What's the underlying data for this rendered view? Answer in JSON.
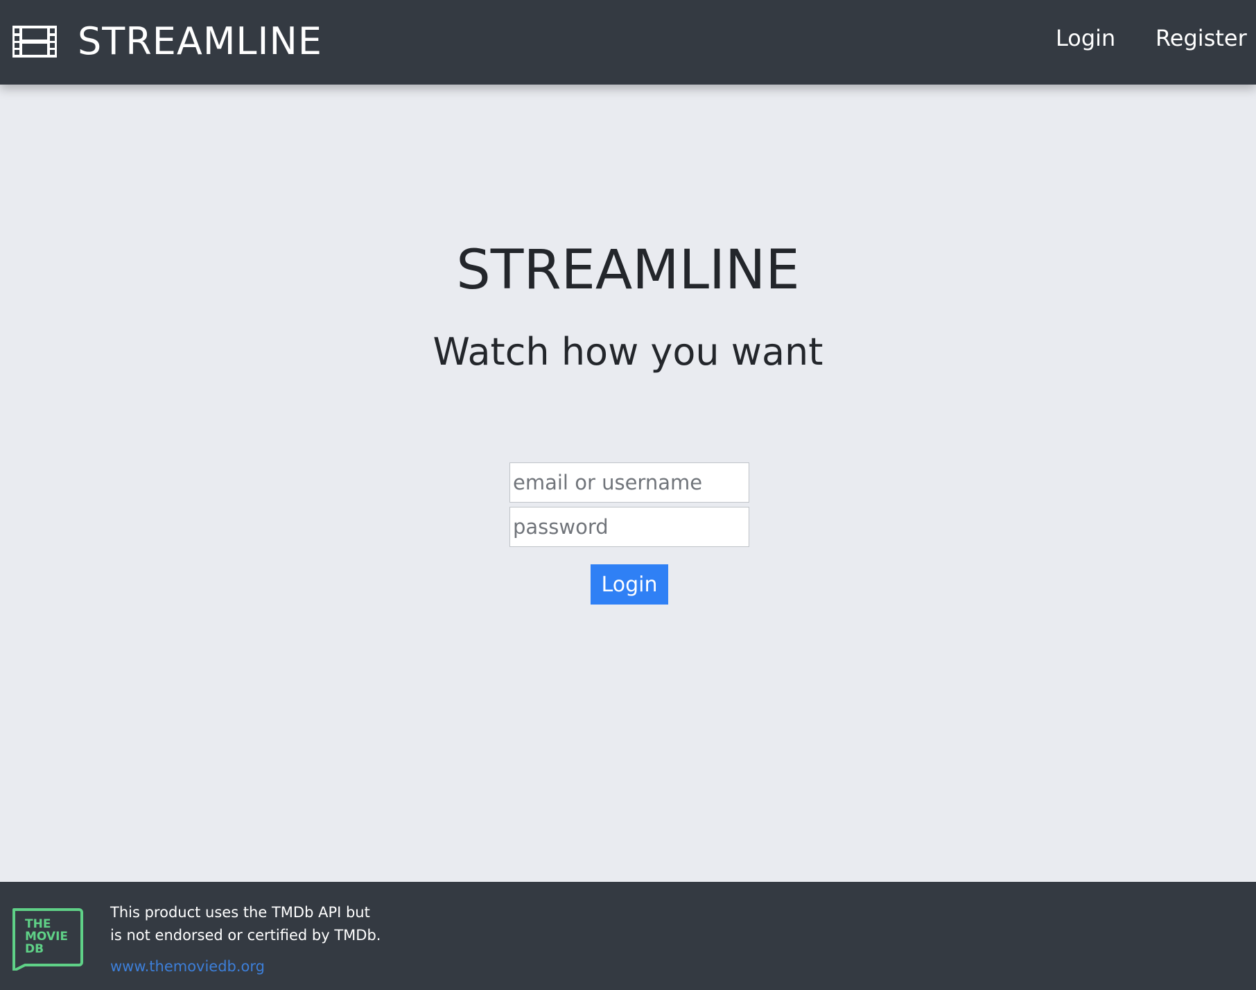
{
  "header": {
    "brand_name": "STREAMLINE",
    "brand_icon": "film-icon",
    "nav": {
      "login_label": "Login",
      "register_label": "Register"
    }
  },
  "hero": {
    "title": "STREAMLINE",
    "subtitle": "Watch how you want"
  },
  "login_form": {
    "username_placeholder": "email or username",
    "username_value": "",
    "password_placeholder": "password",
    "password_value": "",
    "submit_label": "Login"
  },
  "footer": {
    "logo_icon": "tmdb-logo",
    "logo_text": [
      "THE",
      "MOVIE",
      "DB"
    ],
    "note_line1": "This product uses the TMDb API but",
    "note_line2": "is not endorsed or certified by TMDb.",
    "link_text": "www.themoviedb.org"
  },
  "colors": {
    "navbar": "#343a42",
    "page_background": "#e9ebf0",
    "primary_button": "#2f80f5",
    "link": "#3d7fd9",
    "tmdb_green": "#5fd187"
  }
}
